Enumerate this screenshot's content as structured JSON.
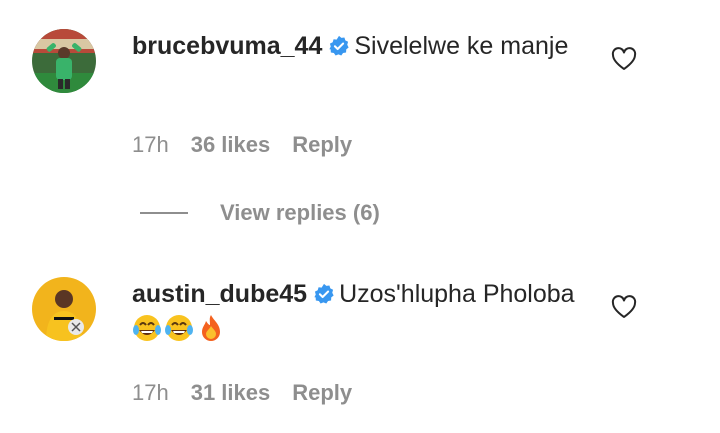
{
  "comments": [
    {
      "username": "brucebvuma_44",
      "text": "Sivelelwe ke manje",
      "time": "17h",
      "likes": "36 likes",
      "reply": "Reply"
    },
    {
      "username": "austin_dube45",
      "text": "Uzos'hlupha Pholoba",
      "time": "17h",
      "likes": "31 likes",
      "reply": "Reply"
    }
  ],
  "view_replies": "View replies (6)",
  "icons": {
    "verified": "verified-badge-icon",
    "like": "heart-outline-icon",
    "emoji_1": "face-with-tears-of-joy",
    "emoji_2": "face-with-tears-of-joy",
    "emoji_3": "fire"
  },
  "colors": {
    "text": "#262626",
    "meta": "#8e8e8e",
    "verified": "#3897f0"
  }
}
